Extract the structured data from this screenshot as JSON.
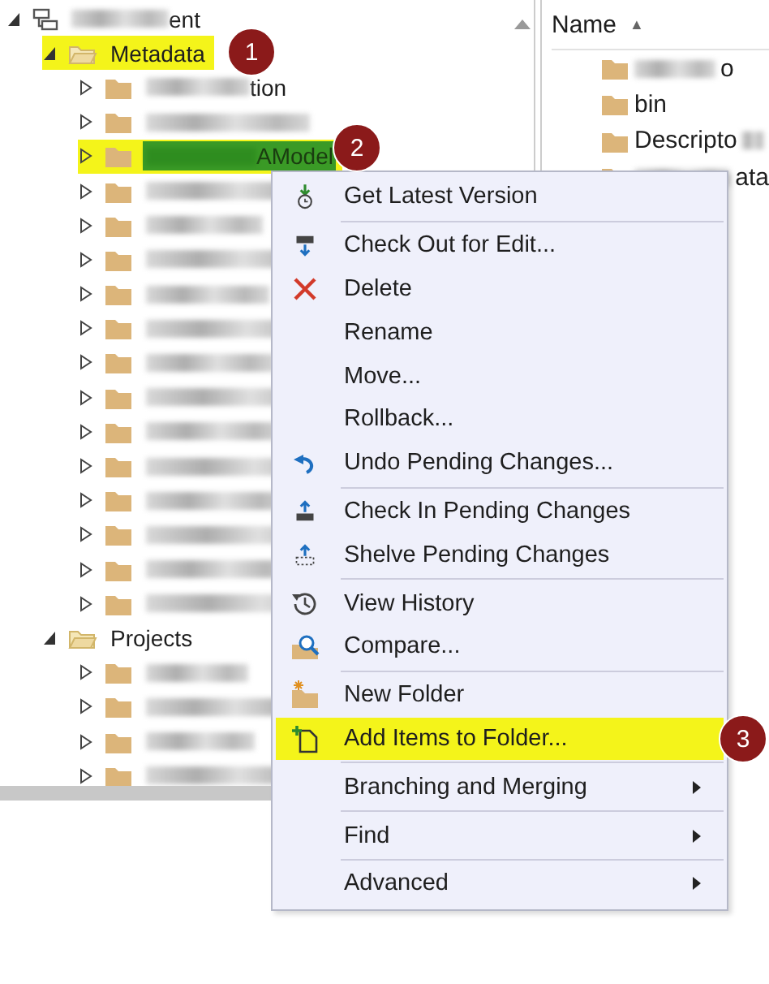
{
  "tree": [
    {
      "label": "ent",
      "kind": "blurred",
      "expanded": true,
      "selected": false,
      "highlighted": false,
      "children": [
        {
          "label": "Metadata",
          "expanded": true,
          "selected": false,
          "highlighted": true,
          "badge": "1",
          "children": [
            {
              "label": "tion",
              "kind": "blurred",
              "expanded": false,
              "selected": false,
              "highlighted": false
            },
            {
              "kind": "blurred",
              "expanded": false,
              "selected": false,
              "highlighted": false
            },
            {
              "label": "AModel",
              "kind": "blurred",
              "expanded": false,
              "selected": true,
              "highlighted": true,
              "badge": "2"
            },
            {
              "kind": "blurred",
              "expanded": false,
              "selected": false,
              "highlighted": false
            },
            {
              "kind": "blurred",
              "expanded": false,
              "selected": false,
              "highlighted": false
            },
            {
              "kind": "blurred",
              "expanded": false,
              "selected": false,
              "highlighted": false
            },
            {
              "kind": "blurred",
              "expanded": false,
              "selected": false,
              "highlighted": false
            },
            {
              "kind": "blurred",
              "expanded": false,
              "selected": false,
              "highlighted": false
            },
            {
              "kind": "blurred",
              "expanded": false,
              "selected": false,
              "highlighted": false
            },
            {
              "kind": "blurred",
              "expanded": false,
              "selected": false,
              "highlighted": false
            },
            {
              "kind": "blurred",
              "expanded": false,
              "selected": false,
              "highlighted": false
            },
            {
              "kind": "blurred",
              "expanded": false,
              "selected": false,
              "highlighted": false
            },
            {
              "kind": "blurred",
              "expanded": false,
              "selected": false,
              "highlighted": false
            },
            {
              "kind": "blurred",
              "expanded": false,
              "selected": false,
              "highlighted": false
            },
            {
              "kind": "blurred",
              "expanded": false,
              "selected": false,
              "highlighted": false
            },
            {
              "kind": "blurred",
              "expanded": false,
              "selected": false,
              "highlighted": false
            }
          ]
        },
        {
          "label": "Projects",
          "expanded": true,
          "selected": false,
          "highlighted": false,
          "children": [
            {
              "kind": "blurred",
              "expanded": false,
              "selected": false,
              "highlighted": false
            },
            {
              "kind": "blurred",
              "expanded": false,
              "selected": false,
              "highlighted": false
            },
            {
              "kind": "blurred",
              "expanded": false,
              "selected": false,
              "highlighted": false
            },
            {
              "kind": "blurred",
              "expanded": false,
              "selected": false,
              "highlighted": false
            }
          ]
        }
      ]
    }
  ],
  "list": {
    "header": "Name",
    "sort_glyph": "▲",
    "items": [
      {
        "label": "o",
        "kind": "blurred"
      },
      {
        "label": "bin"
      },
      {
        "label": "Descripto",
        "kind": "trailing"
      },
      {
        "label": "ata",
        "kind": "blurred"
      }
    ]
  },
  "menu": [
    {
      "label": "Get Latest Version",
      "kind": "get-latest",
      "separator_before": false,
      "highlighted": false,
      "submenu": false
    },
    {
      "label": "Check Out for Edit...",
      "kind": "checkout",
      "separator_before": true,
      "highlighted": false,
      "submenu": false
    },
    {
      "label": "Delete",
      "kind": "delete",
      "separator_before": false,
      "highlighted": false,
      "submenu": false
    },
    {
      "label": "Rename",
      "separator_before": false,
      "highlighted": false,
      "submenu": false
    },
    {
      "label": "Move...",
      "separator_before": false,
      "highlighted": false,
      "submenu": false
    },
    {
      "label": "Rollback...",
      "separator_before": false,
      "highlighted": false,
      "submenu": false
    },
    {
      "label": "Undo Pending Changes...",
      "kind": "undo",
      "separator_before": false,
      "highlighted": false,
      "submenu": false
    },
    {
      "label": "Check In Pending Changes",
      "kind": "checkin",
      "separator_before": true,
      "highlighted": false,
      "submenu": false
    },
    {
      "label": "Shelve Pending Changes",
      "kind": "shelve",
      "separator_before": false,
      "highlighted": false,
      "submenu": false
    },
    {
      "label": "View History",
      "kind": "history",
      "separator_before": true,
      "highlighted": false,
      "submenu": false
    },
    {
      "label": "Compare...",
      "kind": "compare",
      "separator_before": false,
      "highlighted": false,
      "submenu": false
    },
    {
      "label": "New Folder",
      "kind": "new-folder",
      "separator_before": true,
      "highlighted": false,
      "submenu": false
    },
    {
      "label": "Add Items to Folder...",
      "kind": "add-items",
      "separator_before": false,
      "highlighted": true,
      "submenu": false,
      "badge": "3"
    },
    {
      "label": "Branching and Merging",
      "separator_before": true,
      "highlighted": false,
      "submenu": true
    },
    {
      "label": "Find",
      "separator_before": true,
      "highlighted": false,
      "submenu": true
    },
    {
      "label": "Advanced",
      "separator_before": true,
      "highlighted": false,
      "submenu": true
    }
  ]
}
